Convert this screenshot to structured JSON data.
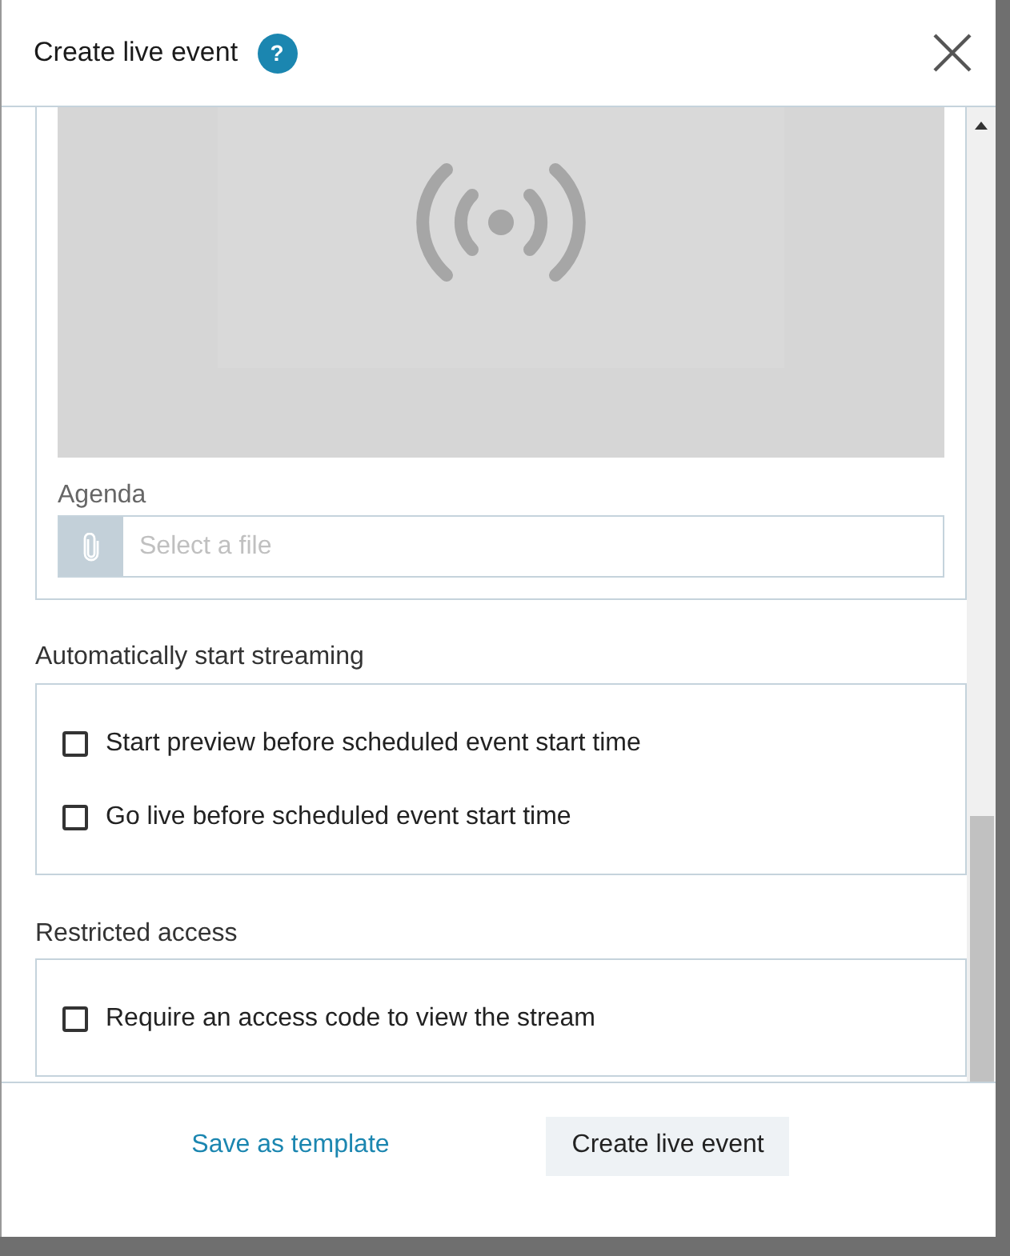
{
  "dialog": {
    "title": "Create live event",
    "help": "?"
  },
  "agenda": {
    "label": "Agenda",
    "placeholder": "Select a file"
  },
  "sections": [
    {
      "heading": "Automatically start streaming",
      "options": [
        {
          "label": "Start preview before scheduled event start time",
          "checked": false
        },
        {
          "label": "Go live before scheduled event start time",
          "checked": false
        }
      ]
    },
    {
      "heading": "Restricted access",
      "options": [
        {
          "label": "Require an access code to view the stream",
          "checked": false
        }
      ]
    }
  ],
  "footer": {
    "link": "Save as template",
    "button": "Create live event"
  }
}
